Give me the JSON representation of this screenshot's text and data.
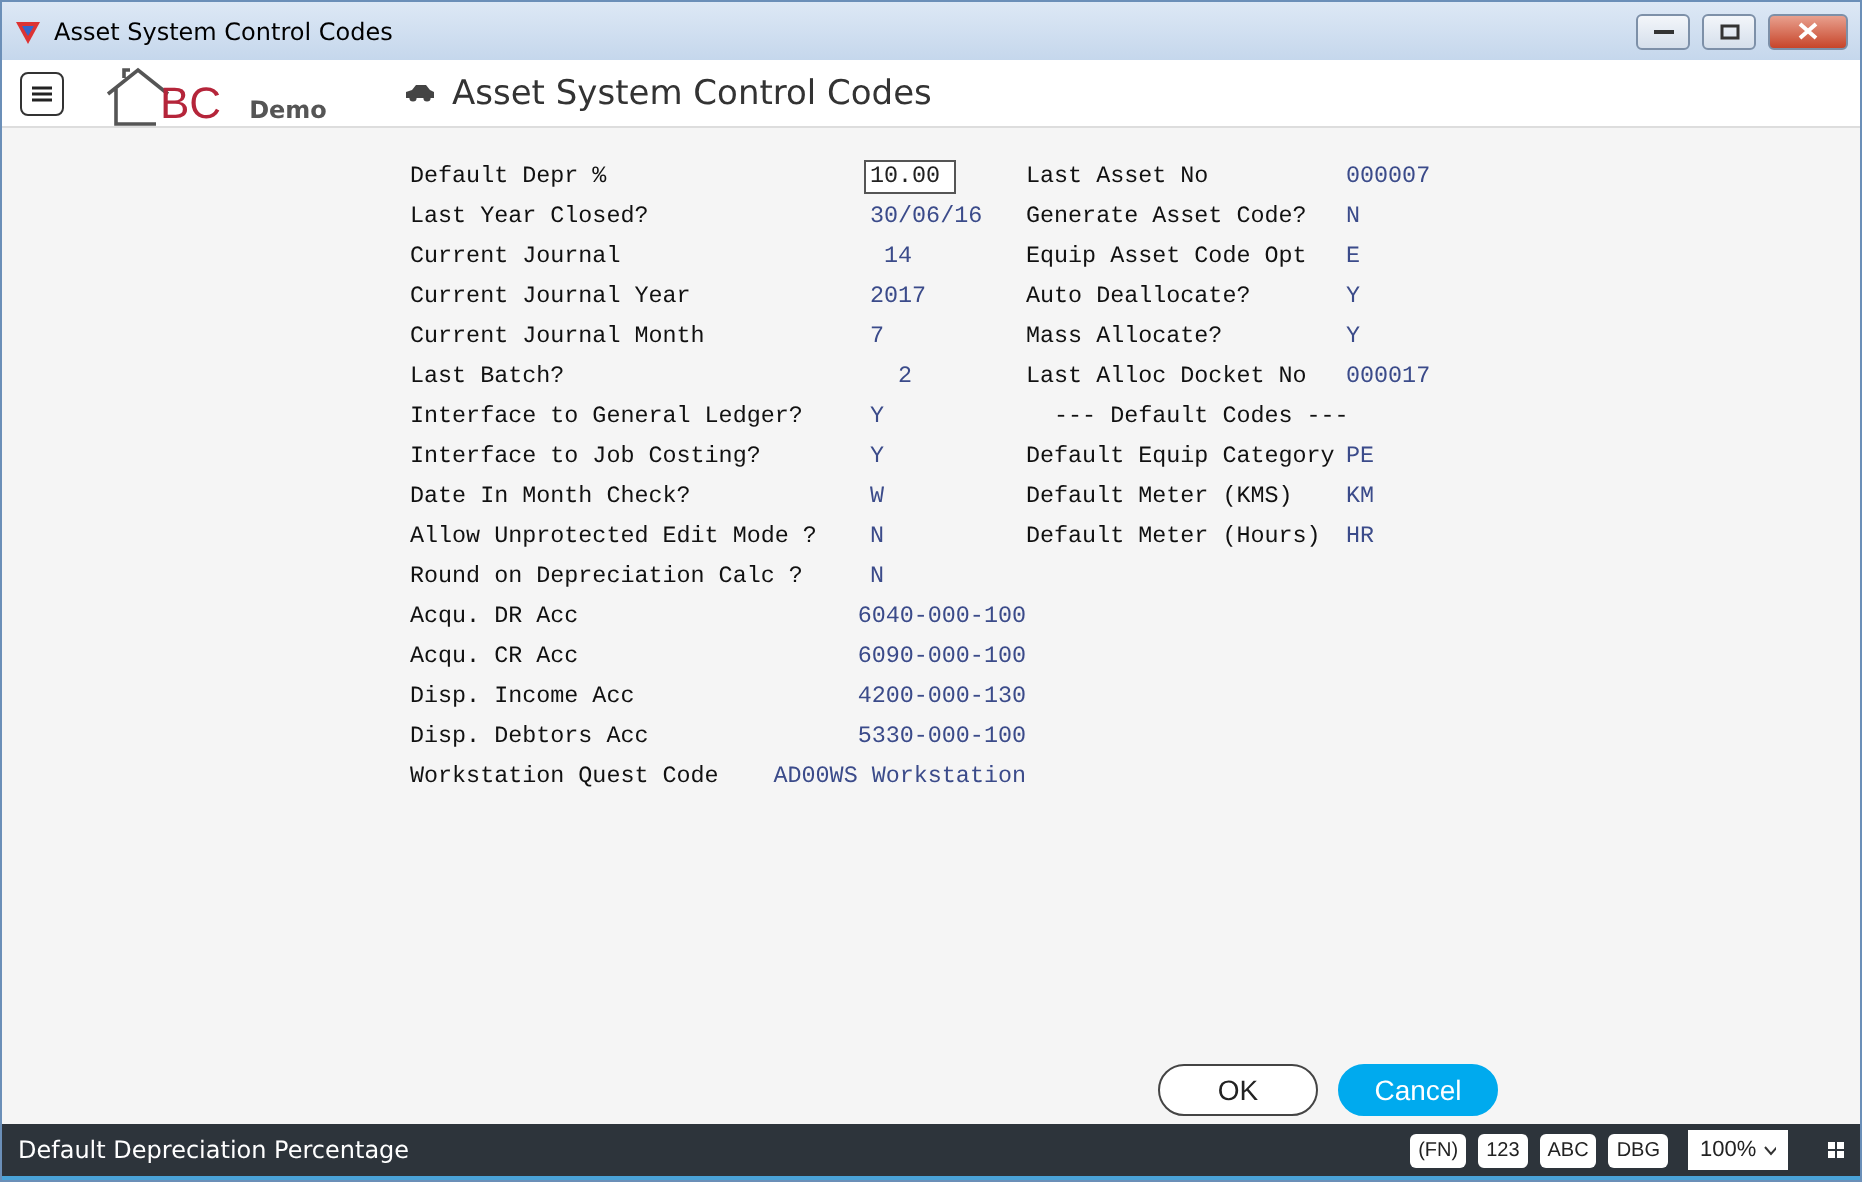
{
  "window": {
    "title": "Asset System Control Codes"
  },
  "header": {
    "logo_letters": "BC",
    "logo_tag": "Demo",
    "title": "Asset System Control Codes"
  },
  "left_fields": [
    {
      "kind": "input",
      "label": "Default Depr %",
      "value": "10.00"
    },
    {
      "kind": "text",
      "label": "Last Year Closed?",
      "value": "30/06/16"
    },
    {
      "kind": "text",
      "label": "Current Journal",
      "value": " 14"
    },
    {
      "kind": "text",
      "label": "Current Journal Year",
      "value": "2017"
    },
    {
      "kind": "text",
      "label": "Current Journal Month",
      "value": "7"
    },
    {
      "kind": "text",
      "label": "Last Batch?",
      "value": "  2"
    },
    {
      "kind": "text",
      "label": "Interface to General Ledger?",
      "value": "Y"
    },
    {
      "kind": "text",
      "label": "Interface to Job Costing?",
      "value": "Y"
    },
    {
      "kind": "text",
      "label": "Date In Month Check?",
      "value": "W"
    },
    {
      "kind": "text",
      "label": "Allow Unprotected Edit Mode ?",
      "value": "N"
    },
    {
      "kind": "text",
      "label": "Round on Depreciation Calc ?",
      "value": "N"
    },
    {
      "kind": "text",
      "label": "Acqu. DR Acc",
      "value": "6040-000-100"
    },
    {
      "kind": "text",
      "label": "Acqu. CR Acc",
      "value": "6090-000-100"
    },
    {
      "kind": "text",
      "label": "Disp. Income Acc",
      "value": "4200-000-130"
    },
    {
      "kind": "text",
      "label": "Disp. Debtors Acc",
      "value": "5330-000-100"
    },
    {
      "kind": "text",
      "label": "Workstation Quest Code",
      "value": "AD00WS Workstation"
    }
  ],
  "right_fields": [
    {
      "kind": "text",
      "label": "Last Asset No",
      "value": "000007"
    },
    {
      "kind": "text",
      "label": "Generate Asset Code?",
      "value": "N"
    },
    {
      "kind": "text",
      "label": "Equip Asset Code Opt",
      "value": "E"
    },
    {
      "kind": "text",
      "label": "Auto Deallocate?",
      "value": "Y"
    },
    {
      "kind": "text",
      "label": "Mass Allocate?",
      "value": "Y"
    },
    {
      "kind": "text",
      "label": "Last Alloc Docket No",
      "value": "000017"
    },
    {
      "kind": "heading",
      "label": "  --- Default Codes ---"
    },
    {
      "kind": "text",
      "label": "Default Equip Category",
      "value": "PE"
    },
    {
      "kind": "text",
      "label": "Default Meter (KMS)",
      "value": "KM"
    },
    {
      "kind": "text",
      "label": "Default Meter (Hours)",
      "value": "HR"
    }
  ],
  "buttons": [
    {
      "label": "OK",
      "kind": "secondary"
    },
    {
      "label": "Cancel",
      "kind": "primary"
    }
  ],
  "status_bar": {
    "message": "Default Depreciation Percentage",
    "keys": [
      "(FN)",
      "123",
      "ABC",
      "DBG"
    ],
    "zoom": "100%"
  }
}
